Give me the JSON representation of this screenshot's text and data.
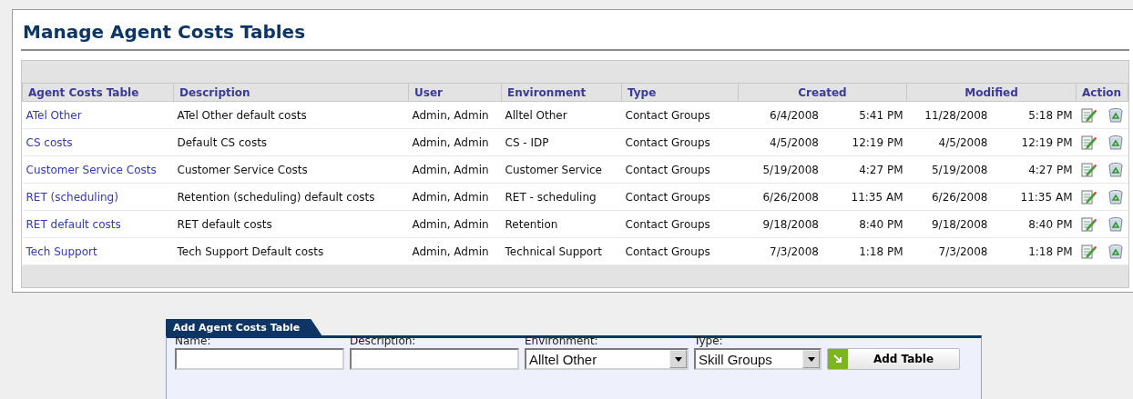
{
  "title": "Manage Agent Costs Tables",
  "table": {
    "columns": [
      {
        "label": "Agent Costs Table",
        "kind": "text"
      },
      {
        "label": "Description",
        "kind": "text"
      },
      {
        "label": "User",
        "kind": "text"
      },
      {
        "label": "Environment",
        "kind": "text"
      },
      {
        "label": "Type",
        "kind": "text"
      },
      {
        "label": "Created",
        "kind": "datetime"
      },
      {
        "label": "Modified",
        "kind": "datetime"
      },
      {
        "label": "Action",
        "kind": "action"
      }
    ],
    "rows": [
      {
        "name": "ATel Other",
        "description": "ATel Other default costs",
        "user": "Admin, Admin",
        "environment": "Alltel Other",
        "type": "Contact Groups",
        "created_date": "6/4/2008",
        "created_time": "5:41 PM",
        "modified_date": "11/28/2008",
        "modified_time": "5:18 PM"
      },
      {
        "name": "CS costs",
        "description": "Default CS costs",
        "user": "Admin, Admin",
        "environment": "CS - IDP",
        "type": "Contact Groups",
        "created_date": "4/5/2008",
        "created_time": "12:19 PM",
        "modified_date": "4/5/2008",
        "modified_time": "12:19 PM"
      },
      {
        "name": "Customer Service Costs",
        "description": "Customer Service Costs",
        "user": "Admin, Admin",
        "environment": "Customer Service",
        "type": "Contact Groups",
        "created_date": "5/19/2008",
        "created_time": "4:27 PM",
        "modified_date": "5/19/2008",
        "modified_time": "4:27 PM"
      },
      {
        "name": "RET (scheduling)",
        "description": "Retention (scheduling) default costs",
        "user": "Admin, Admin",
        "environment": "RET - scheduling",
        "type": "Contact Groups",
        "created_date": "6/26/2008",
        "created_time": "11:35 AM",
        "modified_date": "6/26/2008",
        "modified_time": "11:35 AM"
      },
      {
        "name": "RET default costs",
        "description": "RET default costs",
        "user": "Admin, Admin",
        "environment": "Retention",
        "type": "Contact Groups",
        "created_date": "9/18/2008",
        "created_time": "8:40 PM",
        "modified_date": "9/18/2008",
        "modified_time": "8:40 PM"
      },
      {
        "name": "Tech Support",
        "description": "Tech Support Default costs",
        "user": "Admin, Admin",
        "environment": "Technical Support",
        "type": "Contact Groups",
        "created_date": "7/3/2008",
        "created_time": "1:18 PM",
        "modified_date": "7/3/2008",
        "modified_time": "1:18 PM"
      }
    ]
  },
  "add_form": {
    "title": "Add Agent Costs Table",
    "fields": [
      {
        "label": "Name:",
        "kind": "text"
      },
      {
        "label": "Description:",
        "kind": "text"
      },
      {
        "label": "Environment:",
        "kind": "select",
        "value": "Alltel Other"
      },
      {
        "label": "Type:",
        "kind": "select",
        "value": "Skill Groups"
      }
    ],
    "button": "Add Table"
  }
}
